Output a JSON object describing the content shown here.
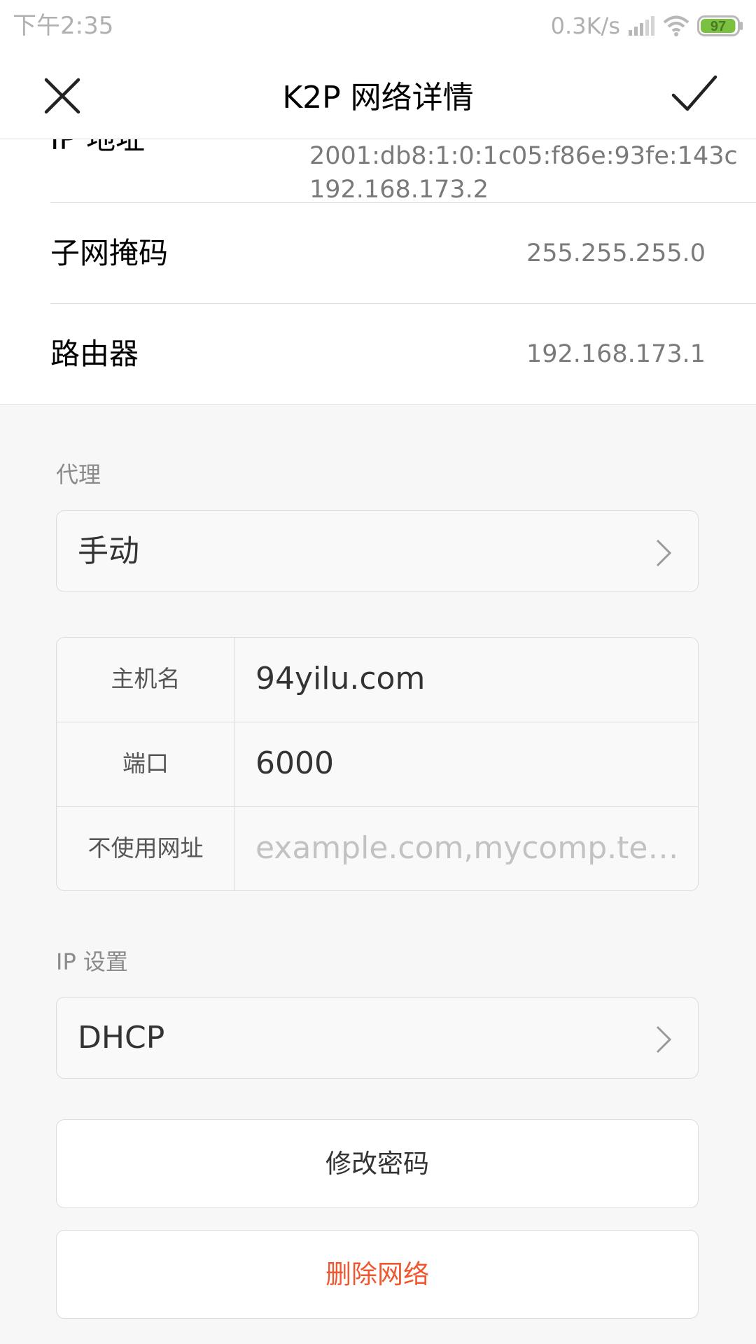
{
  "status_bar": {
    "time": "下午2:35",
    "net_speed": "0.3K/s",
    "battery_level": "97",
    "battery_color": "#7ac142",
    "icons": [
      "signal-icon",
      "wifi-icon",
      "battery-icon"
    ]
  },
  "header": {
    "title": "K2P  网络详情",
    "close_icon": "close-icon",
    "confirm_icon": "check-icon"
  },
  "info": {
    "ip_label": "IP 地址",
    "ip_values": [
      "2001:db8:1:0:1c05:f86e:93fe:143c",
      "192.168.173.2"
    ],
    "rows": [
      {
        "label": "子网掩码",
        "value": "255.255.255.0"
      },
      {
        "label": "路由器",
        "value": "192.168.173.1"
      }
    ]
  },
  "proxy": {
    "section_label": "代理",
    "mode": "手动",
    "fields": [
      {
        "label": "主机名",
        "value": "94yilu.com",
        "placeholder": ""
      },
      {
        "label": "端口",
        "value": "6000",
        "placeholder": ""
      },
      {
        "label": "不使用网址",
        "value": "",
        "placeholder": "example.com,mycomp.test.c..."
      }
    ]
  },
  "ip_settings": {
    "section_label": "IP 设置",
    "mode": "DHCP"
  },
  "actions": {
    "change_password": "修改密码",
    "delete_network": "删除网络",
    "delete_color": "#f1572f"
  }
}
